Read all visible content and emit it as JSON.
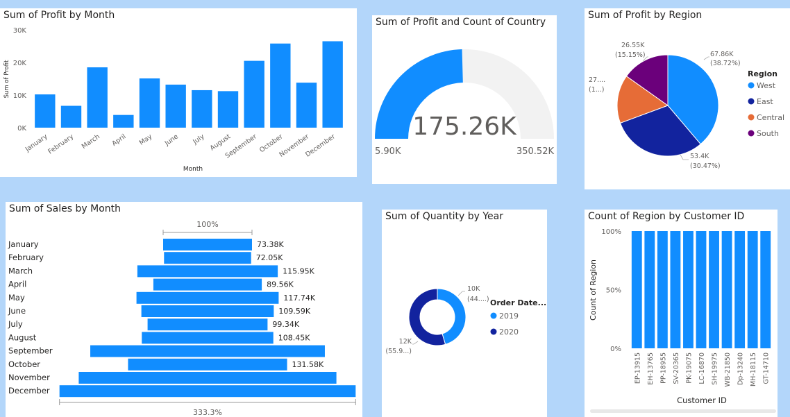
{
  "colors": {
    "accent": "#118dff",
    "navy": "#12239e",
    "orange": "#e66c37",
    "purple": "#6b007b",
    "track": "#f2f2f2",
    "axis": "#605e5c",
    "bg": "#b3d6fa"
  },
  "profit_by_month": {
    "title": "Sum of Profit by Month",
    "chart_data": {
      "type": "bar",
      "title": "Sum of Profit by Month",
      "xlabel": "Month",
      "ylabel": "Sum of Profit",
      "categories": [
        "January",
        "February",
        "March",
        "April",
        "May",
        "June",
        "July",
        "August",
        "September",
        "October",
        "November",
        "December"
      ],
      "values": [
        10200,
        6700,
        18500,
        3900,
        15100,
        13200,
        11500,
        11200,
        20500,
        25800,
        13800,
        26500
      ],
      "yticks": [
        "0K",
        "10K",
        "20K",
        "30K"
      ],
      "ylim": [
        0,
        30000
      ]
    }
  },
  "gauge": {
    "title": "Sum of Profit and Count of Country",
    "chart_data": {
      "type": "gauge",
      "value_label": "175.26K",
      "min_label": "5.90K",
      "max_label": "350.52K",
      "value": 175260,
      "min": 5900,
      "max": 350520
    }
  },
  "profit_by_region": {
    "title": "Sum of Profit by Region",
    "legend_title": "Region",
    "chart_data": {
      "type": "pie",
      "categories": [
        "West",
        "East",
        "Central",
        "South"
      ],
      "values": [
        67860,
        53400,
        27000,
        26550
      ],
      "colors": [
        "#118dff",
        "#12239e",
        "#e66c37",
        "#6b007b"
      ],
      "legend_placement": "right"
    },
    "labels": {
      "west": [
        "67.86K",
        "(38.72%)"
      ],
      "east": [
        "53.4K",
        "(30.47%)"
      ],
      "central": [
        "27....",
        "(1...)"
      ],
      "south": [
        "26.55K",
        "(15.15%)"
      ]
    }
  },
  "sales_by_month": {
    "title": "Sum of Sales by Month",
    "top_label": "100%",
    "bottom_label": "333.3%",
    "chart_data": {
      "type": "bar",
      "orientation": "horizontal-funnel",
      "categories": [
        "January",
        "February",
        "March",
        "April",
        "May",
        "June",
        "July",
        "August",
        "September",
        "October",
        "November",
        "December"
      ],
      "values": [
        73380,
        72050,
        115950,
        89560,
        117740,
        109590,
        99340,
        108450,
        null,
        131580,
        null,
        null
      ],
      "data_labels": [
        "73.38K",
        "72.05K",
        "115.95K",
        "89.56K",
        "117.74K",
        "109.59K",
        "99.34K",
        "108.45K",
        "",
        "131.58K",
        "",
        ""
      ],
      "relative_widths": [
        1.0,
        0.98,
        1.58,
        1.22,
        1.6,
        1.49,
        1.35,
        1.48,
        2.64,
        1.79,
        2.9,
        3.333
      ]
    }
  },
  "quantity_by_year": {
    "title": "Sum of Quantity by Year",
    "legend_title": "Order Date...",
    "chart_data": {
      "type": "pie",
      "style": "donut",
      "categories": [
        "2019",
        "2020"
      ],
      "values": [
        10000,
        12000
      ],
      "colors": [
        "#118dff",
        "#12239e"
      ]
    },
    "labels": {
      "y2019": [
        "10K",
        "(44....)"
      ],
      "y2020": [
        "12K",
        "(55.9...)"
      ]
    }
  },
  "region_by_customer": {
    "title": "Count of Region by Customer ID",
    "chart_data": {
      "type": "bar",
      "xlabel": "Customer ID",
      "ylabel": "Count of Region",
      "categories": [
        "EP-13915",
        "EH-13765",
        "PP-18955",
        "SV-20365",
        "PK-19075",
        "LC-16870",
        "SH-19975",
        "WB-21850",
        "Dp-13240",
        "MH-18115",
        "GT-14710"
      ],
      "values": [
        100,
        100,
        100,
        100,
        100,
        100,
        100,
        100,
        100,
        100,
        100
      ],
      "yticks": [
        "0%",
        "50%",
        "100%"
      ],
      "ylim": [
        0,
        100
      ]
    }
  }
}
